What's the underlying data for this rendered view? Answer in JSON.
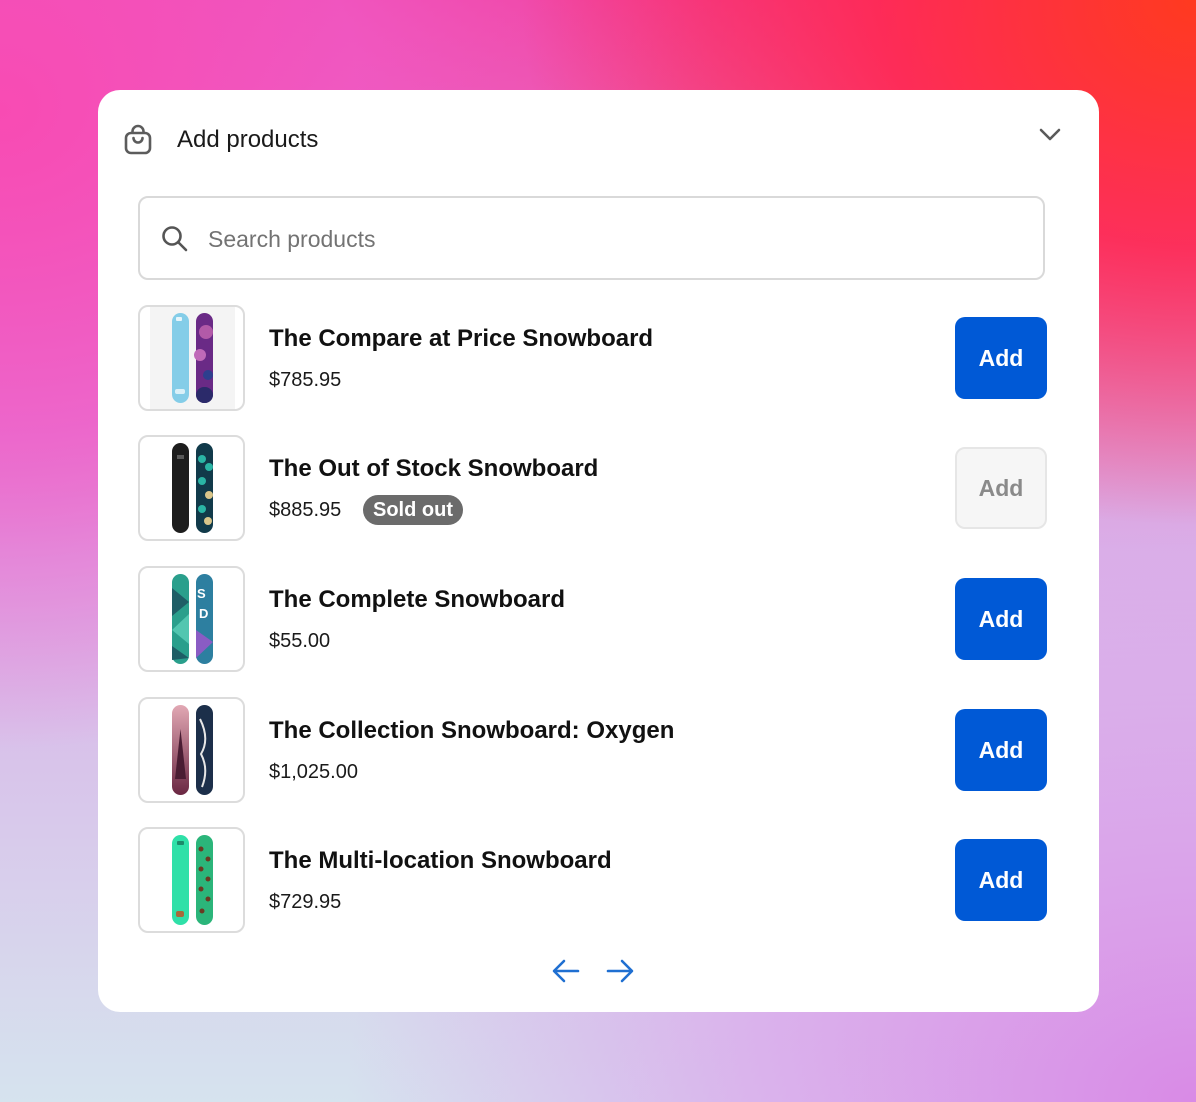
{
  "header": {
    "title": "Add products",
    "icon": "shopping-bag-icon",
    "toggle_icon": "chevron-down-icon"
  },
  "search": {
    "placeholder": "Search products",
    "value": "",
    "icon": "search-icon"
  },
  "products": [
    {
      "name": "The Compare at Price Snowboard",
      "price": "$785.95",
      "badge": "",
      "add_label": "Add",
      "available": true
    },
    {
      "name": "The Out of Stock Snowboard",
      "price": "$885.95",
      "badge": "Sold out",
      "add_label": "Add",
      "available": false
    },
    {
      "name": "The Complete Snowboard",
      "price": "$55.00",
      "badge": "",
      "add_label": "Add",
      "available": true
    },
    {
      "name": "The Collection Snowboard: Oxygen",
      "price": "$1,025.00",
      "badge": "",
      "add_label": "Add",
      "available": true
    },
    {
      "name": "The Multi-location Snowboard",
      "price": "$729.95",
      "badge": "",
      "add_label": "Add",
      "available": true
    }
  ],
  "pagination": {
    "prev_icon": "arrow-left-icon",
    "next_icon": "arrow-right-icon"
  },
  "colors": {
    "primary": "#0059d6",
    "badge": "#6b6b6b",
    "pagination_arrow": "#1f6fd1"
  }
}
